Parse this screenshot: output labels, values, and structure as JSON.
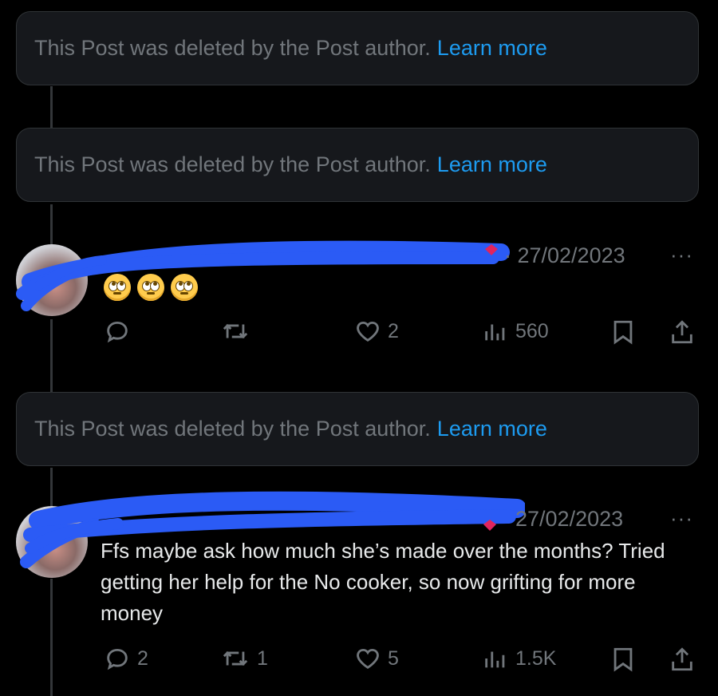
{
  "deleted_notice": {
    "text": "This Post was deleted by the Post author.",
    "link": "Learn more"
  },
  "reply1": {
    "date": "· 27/02/2023",
    "more": "···",
    "emoji": [
      "face-with-rolling-eyes",
      "face-with-rolling-eyes",
      "face-with-rolling-eyes"
    ],
    "actions": {
      "reply_count": "",
      "repost_count": "",
      "like_count": "2",
      "views": "560"
    }
  },
  "reply2": {
    "date": "27/02/2023",
    "more": "···",
    "text": "Ffs maybe ask how much she’s made over the months? Tried getting her help for the No cooker, so now grifting for more money",
    "actions": {
      "reply_count": "2",
      "repost_count": "1",
      "like_count": "5",
      "views": "1.5K"
    }
  },
  "colors": {
    "background": "#000000",
    "card": "#16181c",
    "muted": "#71767b",
    "link": "#1d9bf0",
    "redaction": "#2b5bf5"
  }
}
